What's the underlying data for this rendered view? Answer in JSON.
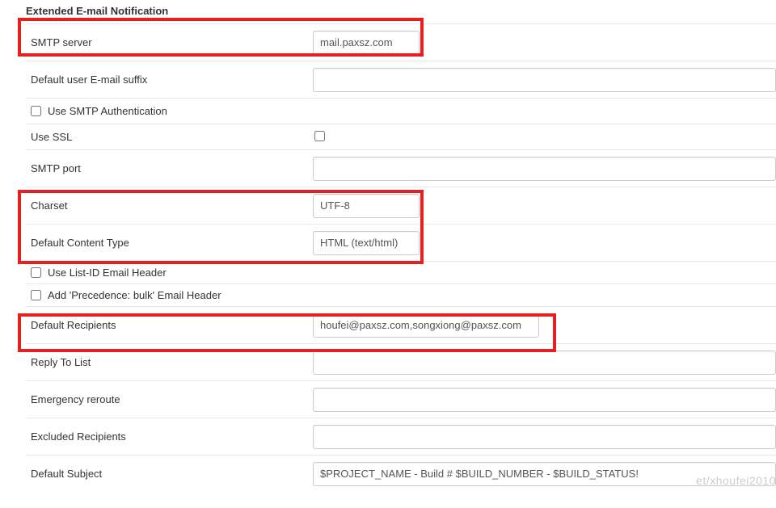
{
  "section_title": "Extended E-mail Notification",
  "rows": {
    "smtp_server": {
      "label": "SMTP server",
      "value": "mail.paxsz.com"
    },
    "default_suffix": {
      "label": "Default user E-mail suffix",
      "value": ""
    },
    "use_smtp_auth": {
      "label": "Use SMTP Authentication",
      "checked": false
    },
    "use_ssl": {
      "label": "Use SSL",
      "checked": false
    },
    "smtp_port": {
      "label": "SMTP port",
      "value": ""
    },
    "charset": {
      "label": "Charset",
      "value": "UTF-8"
    },
    "default_content_type": {
      "label": "Default Content Type",
      "value": "HTML (text/html)"
    },
    "use_list_id": {
      "label": "Use List-ID Email Header",
      "checked": false
    },
    "add_precedence": {
      "label": "Add 'Precedence: bulk' Email Header",
      "checked": false
    },
    "default_recipients": {
      "label": "Default Recipients",
      "value": "houfei@paxsz.com,songxiong@paxsz.com"
    },
    "reply_to_list": {
      "label": "Reply To List",
      "value": ""
    },
    "emergency_reroute": {
      "label": "Emergency reroute",
      "value": ""
    },
    "excluded_recipients": {
      "label": "Excluded Recipients",
      "value": ""
    },
    "default_subject": {
      "label": "Default Subject",
      "value": "$PROJECT_NAME - Build # $BUILD_NUMBER - $BUILD_STATUS!"
    }
  },
  "watermark": "et/xhoufei2010"
}
